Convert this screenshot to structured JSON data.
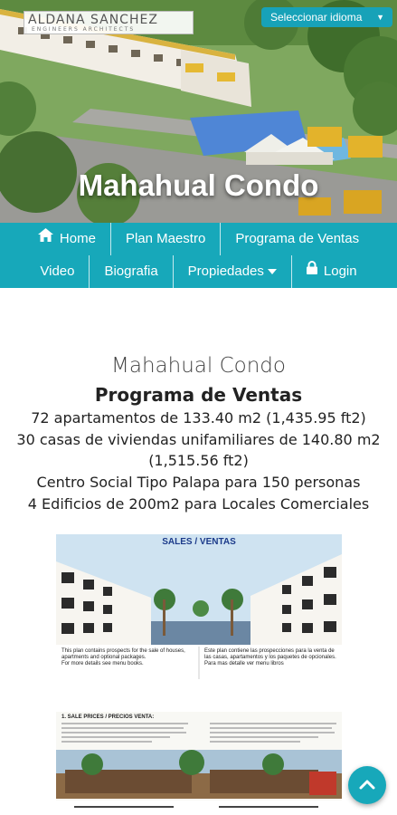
{
  "header": {
    "logo_name": "ALDANA SANCHEZ",
    "logo_tagline": "ENGINEERS ARCHITECTS",
    "language_button": "Seleccionar idioma",
    "hero_title": "Mahahual Condo"
  },
  "nav": {
    "row1": [
      {
        "label": "Home",
        "icon": "home-icon"
      },
      {
        "label": "Plan Maestro"
      },
      {
        "label": "Programa de Ventas"
      }
    ],
    "row2": [
      {
        "label": "Video"
      },
      {
        "label": "Biografia"
      },
      {
        "label": "Propiedades",
        "icon": "caret-down-icon"
      },
      {
        "label": "Login",
        "icon": "lock-icon"
      }
    ]
  },
  "content": {
    "title": "Mahahual Condo",
    "subtitle": "Programa de Ventas",
    "lines": [
      "72 apartamentos de 133.40 m2 (1,435.95 ft2)",
      "30 casas de viviendas unifamiliares de 140.80 m2",
      "(1,515.56 ft2)",
      "Centro Social Tipo Palapa para 150 personas",
      "4 Edificios de 200m2 para Locales Comerciales"
    ]
  },
  "brochure": {
    "heading": "SALES / VENTAS",
    "left_notes": [
      "This plan contains prospects for the sale of houses, apartments and optional packages.",
      "For more details see menu books."
    ],
    "right_notes": [
      "Este plan contiene las prospecciones para la venta de las casas, apartamentos y los paquetes de opcionales.",
      "Para mas detalle ver menu libros"
    ],
    "sale_price_title": "1. SALE PRICES / PRECIOS VENTA:"
  },
  "colors": {
    "accent": "#17a8ba",
    "accent_dark": "#17a2b8",
    "text": "#222222"
  }
}
